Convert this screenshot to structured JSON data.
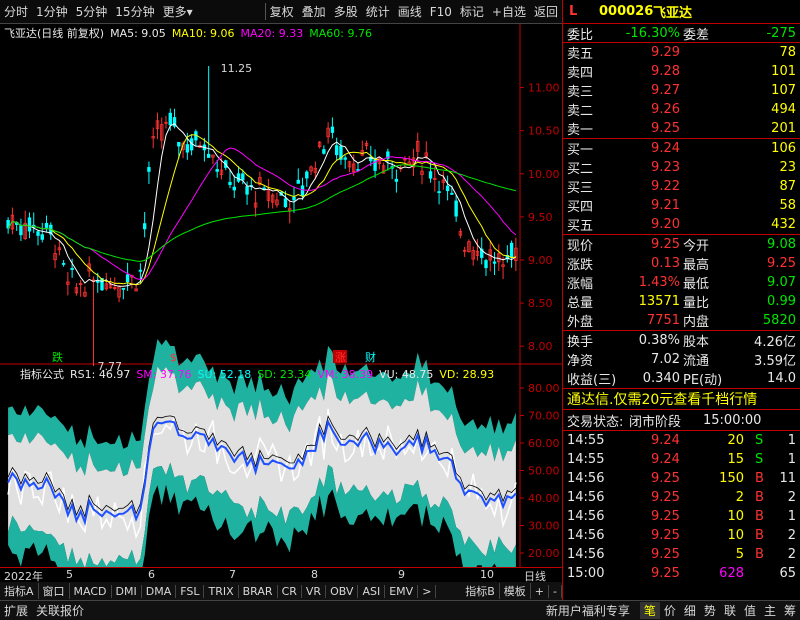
{
  "toolbar": {
    "items": [
      "分时",
      "1分钟",
      "5分钟",
      "15分钟",
      "更多"
    ],
    "more_arrow": "▾",
    "right_items": [
      "复权",
      "叠加",
      "多股",
      "统计",
      "画线",
      "F10",
      "标记",
      "+自选",
      "返回"
    ]
  },
  "kline_info": {
    "name": "飞亚达(日线 前复权)",
    "ma5": "MA5: 9.05",
    "ma10": "MA10: 9.06",
    "ma20": "MA20: 9.33",
    "ma60": "MA60: 9.76"
  },
  "price_axis": [
    "11.00",
    "10.50",
    "10.00",
    "9.50",
    "9.00",
    "8.50",
    "8.00"
  ],
  "annotations": {
    "high": "11.25",
    "low": "7.77"
  },
  "event_marks": [
    "跌",
    "$",
    "涨",
    "财"
  ],
  "indicator_info": {
    "name": "指标公式",
    "rs1": "RS1: 46.97",
    "sm": "SM: 37.76",
    "su": "SU: 52.18",
    "sd": "SD: 23.34",
    "vm": "VM: 38.39",
    "vu": "VU: 48.75",
    "vd": "VD: 28.93"
  },
  "ind_axis": [
    "80.00",
    "70.00",
    "60.00",
    "50.00",
    "40.00",
    "30.00",
    "20.00"
  ],
  "date_axis": {
    "year": "2022年",
    "months": [
      "5",
      "6",
      "7",
      "8",
      "9",
      "10"
    ],
    "period": "日线"
  },
  "bottom_tabs": [
    "指标A",
    "窗口",
    "MACD",
    "DMI",
    "DMA",
    "FSL",
    "TRIX",
    "BRAR",
    "CR",
    "VR",
    "OBV",
    "ASI",
    "EMV",
    ">",
    "指标B",
    "模板",
    "+",
    "-"
  ],
  "status_bar": {
    "left": [
      "扩展",
      "关联报价"
    ],
    "right": "新用户福利专享",
    "tabs": [
      "笔",
      "价",
      "细",
      "势",
      "联",
      "值",
      "主",
      "筹"
    ]
  },
  "quote": {
    "flag": "L",
    "code": "000026",
    "name": "飞亚达",
    "weibi_label": "委比",
    "weibi": "-16.30%",
    "weicha_label": "委差",
    "weicha": "-275",
    "sells": [
      {
        "label": "卖五",
        "price": "9.29",
        "vol": "78"
      },
      {
        "label": "卖四",
        "price": "9.28",
        "vol": "101"
      },
      {
        "label": "卖三",
        "price": "9.27",
        "vol": "107"
      },
      {
        "label": "卖二",
        "price": "9.26",
        "vol": "494"
      },
      {
        "label": "卖一",
        "price": "9.25",
        "vol": "201"
      }
    ],
    "buys": [
      {
        "label": "买一",
        "price": "9.24",
        "vol": "106"
      },
      {
        "label": "买二",
        "price": "9.23",
        "vol": "23"
      },
      {
        "label": "买三",
        "price": "9.22",
        "vol": "87"
      },
      {
        "label": "买四",
        "price": "9.21",
        "vol": "58"
      },
      {
        "label": "买五",
        "price": "9.20",
        "vol": "432"
      }
    ],
    "stats1": [
      {
        "l1": "现价",
        "v1": "9.25",
        "c1": "red",
        "l2": "今开",
        "v2": "9.08",
        "c2": "grn"
      },
      {
        "l1": "涨跌",
        "v1": "0.13",
        "c1": "red",
        "l2": "最高",
        "v2": "9.25",
        "c2": "red"
      },
      {
        "l1": "涨幅",
        "v1": "1.43%",
        "c1": "red",
        "l2": "最低",
        "v2": "9.07",
        "c2": "grn"
      },
      {
        "l1": "总量",
        "v1": "13571",
        "c1": "yel",
        "l2": "量比",
        "v2": "0.99",
        "c2": "grn"
      },
      {
        "l1": "外盘",
        "v1": "7751",
        "c1": "red",
        "l2": "内盘",
        "v2": "5820",
        "c2": "grn"
      }
    ],
    "stats2": [
      {
        "l1": "换手",
        "v1": "0.38%",
        "l2": "股本",
        "v2": "4.26亿"
      },
      {
        "l1": "净资",
        "v1": "7.02",
        "l2": "流通",
        "v2": "3.59亿"
      },
      {
        "l1": "收益(三)",
        "v1": "0.340",
        "l2": "PE(动)",
        "v2": "14.0"
      }
    ],
    "promo": "通达信.仅需20元查看千档行情",
    "trade_status_label": "交易状态:",
    "trade_status": "闭市阶段",
    "trade_time": "15:00:00",
    "ticks": [
      {
        "t": "14:55",
        "p": "9.24",
        "v": "20",
        "d": "S",
        "n": "1"
      },
      {
        "t": "14:55",
        "p": "9.24",
        "v": "15",
        "d": "S",
        "n": "1"
      },
      {
        "t": "14:56",
        "p": "9.25",
        "v": "150",
        "d": "B",
        "n": "11"
      },
      {
        "t": "14:56",
        "p": "9.25",
        "v": "2",
        "d": "B",
        "n": "2"
      },
      {
        "t": "14:56",
        "p": "9.25",
        "v": "10",
        "d": "B",
        "n": "1"
      },
      {
        "t": "14:56",
        "p": "9.25",
        "v": "10",
        "d": "B",
        "n": "2"
      },
      {
        "t": "14:56",
        "p": "9.25",
        "v": "5",
        "d": "B",
        "n": "2"
      },
      {
        "t": "15:00",
        "p": "9.25",
        "v": "628",
        "d": "",
        "n": "65"
      }
    ]
  }
}
